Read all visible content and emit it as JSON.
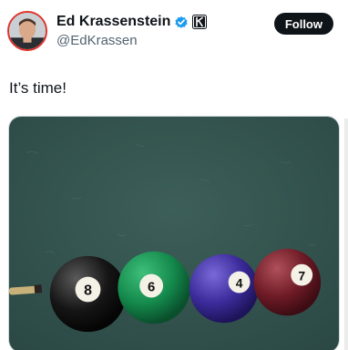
{
  "tweet": {
    "author": {
      "display_name": "Ed Krassenstein",
      "handle": "@EdKrassen",
      "avatar_icon": "avatar-photo",
      "verified_icon": "verified-badge-icon",
      "affiliate_icon": "affiliate-logo-icon"
    },
    "follow_label": "Follow",
    "text": "It’s time!",
    "media": {
      "description_icon": "pool-balls-photo",
      "balls": [
        "8",
        "6",
        "4",
        "7"
      ],
      "felt_color": "#33544f"
    }
  },
  "colors": {
    "follow_bg": "#0f1419",
    "verified": "#1d9bf0",
    "handle": "#536471",
    "text": "#0f1419"
  }
}
